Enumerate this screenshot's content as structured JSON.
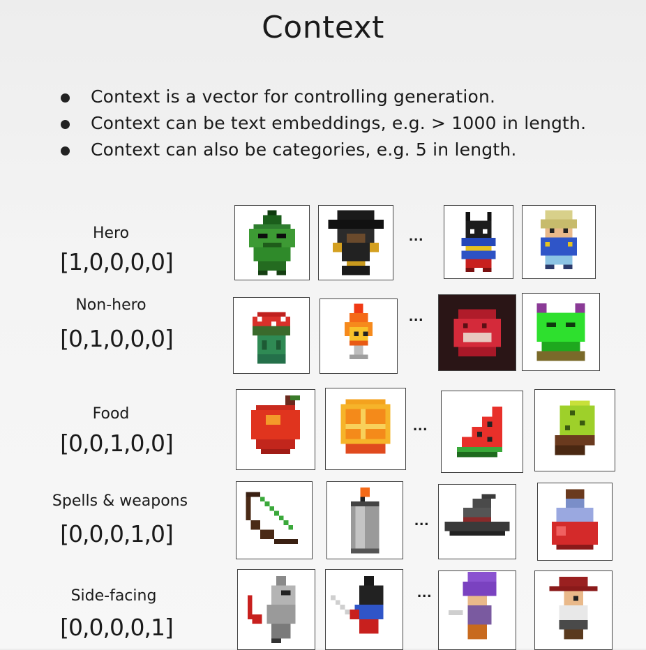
{
  "title": "Context",
  "bullets": [
    "Context is a vector for controlling generation.",
    "Context can be text embeddings, e.g. > 1000 in length.",
    "Context can also be categories, e.g. 5 in length."
  ],
  "categories": [
    {
      "label": "Hero",
      "vector": "[1,0,0,0,0]"
    },
    {
      "label": "Non-hero",
      "vector": "[0,1,0,0,0]"
    },
    {
      "label": "Food",
      "vector": "[0,0,1,0,0]"
    },
    {
      "label": "Spells & weapons",
      "vector": "[0,0,0,1,0]"
    },
    {
      "label": "Side-facing",
      "vector": "[0,0,0,0,1]"
    }
  ],
  "ellipsis": "...",
  "sprites": {
    "hero": [
      "green-goblin-sprite",
      "dark-hat-hero-sprite",
      "black-cat-hero-sprite",
      "blonde-hero-sprite"
    ],
    "non_hero": [
      "mushroom-creature-sprite",
      "fire-spirit-sprite",
      "red-slime-sprite",
      "green-frog-monster-sprite"
    ],
    "food": [
      "apple-sprite",
      "orange-slice-sprite",
      "watermelon-slice-sprite",
      "kiwi-slice-sprite"
    ],
    "spells_weapons": [
      "bow-sprite",
      "candle-sprite",
      "witch-hat-sprite",
      "red-potion-sprite"
    ],
    "side_facing": [
      "armored-knight-sprite",
      "dark-ninja-sprite",
      "purple-hair-hero-sprite",
      "red-hat-hero-sprite"
    ]
  }
}
